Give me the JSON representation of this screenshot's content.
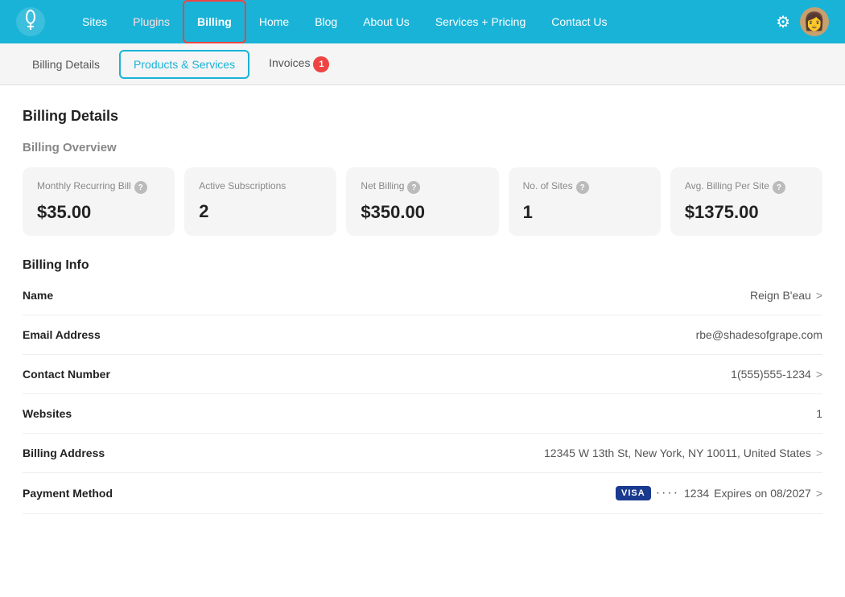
{
  "nav": {
    "links": [
      {
        "label": "Sites",
        "id": "sites",
        "active": false,
        "class": ""
      },
      {
        "label": "Plugins",
        "id": "plugins",
        "active": false,
        "class": "plugins"
      },
      {
        "label": "Billing",
        "id": "billing",
        "active": true,
        "class": "active"
      },
      {
        "label": "Home",
        "id": "home",
        "active": false,
        "class": ""
      },
      {
        "label": "Blog",
        "id": "blog",
        "active": false,
        "class": ""
      },
      {
        "label": "About Us",
        "id": "about",
        "active": false,
        "class": ""
      },
      {
        "label": "Services + Pricing",
        "id": "services",
        "active": false,
        "class": ""
      },
      {
        "label": "Contact Us",
        "id": "contact",
        "active": false,
        "class": ""
      }
    ]
  },
  "subnav": {
    "items": [
      {
        "label": "Billing Details",
        "id": "billing-details",
        "active": false
      },
      {
        "label": "Products & Services",
        "id": "products-services",
        "active": true
      },
      {
        "label": "Invoices",
        "id": "invoices",
        "active": false,
        "badge": "1"
      }
    ]
  },
  "billing_details": {
    "title": "Billing Details",
    "overview_title": "Billing Overview",
    "cards": [
      {
        "label": "Monthly Recurring Bill",
        "has_help": true,
        "value": "$35.00"
      },
      {
        "label": "Active Subscriptions",
        "has_help": false,
        "value": "2"
      },
      {
        "label": "Net Billing",
        "has_help": true,
        "value": "$350.00"
      },
      {
        "label": "No. of Sites",
        "has_help": true,
        "value": "1"
      },
      {
        "label": "Avg. Billing Per Site",
        "has_help": true,
        "value": "$1375.00"
      }
    ],
    "info_title": "Billing Info",
    "info_rows": [
      {
        "label": "Name",
        "value": "Reign B'eau",
        "has_chevron": true
      },
      {
        "label": "Email Address",
        "value": "rbe@shadesofgrape.com",
        "has_chevron": false
      },
      {
        "label": "Contact Number",
        "value": "1(555)555-1234",
        "has_chevron": true
      },
      {
        "label": "Websites",
        "value": "1",
        "has_chevron": false
      },
      {
        "label": "Billing Address",
        "value": "12345 W 13th St, New York, NY 10011, United States",
        "has_chevron": true
      },
      {
        "label": "Payment Method",
        "value": "···· 1234   Expires on  08/2027",
        "has_chevron": true,
        "is_payment": true
      }
    ]
  },
  "icons": {
    "help": "?",
    "chevron": ">",
    "gear": "⚙",
    "avatar": "👩"
  }
}
